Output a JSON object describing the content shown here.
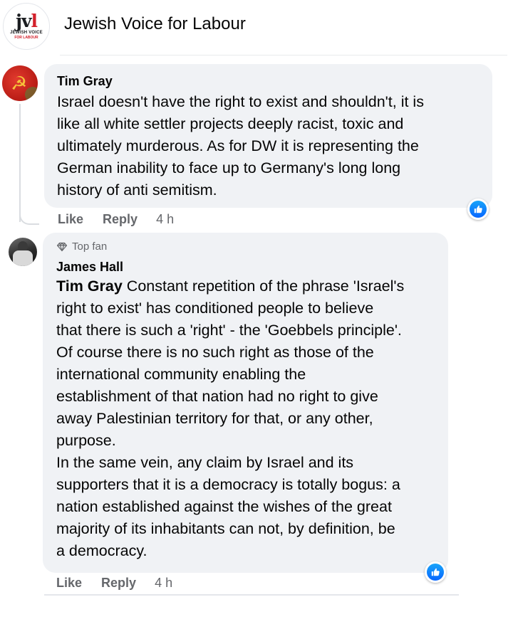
{
  "page": {
    "title": "Jewish Voice for Labour",
    "logo": {
      "mark_black": "jv",
      "mark_red": "l",
      "line1": "JEWISH VOICE",
      "line2": "FOR LABOUR"
    }
  },
  "comments": [
    {
      "author": "Tim Gray",
      "text": "Israel doesn't have the right to exist and shouldn't, it is\nlike all white settler projects deeply racist, toxic and\nultimately murderous. As for DW it is representing the\nGerman inability to face up to Germany's long long\nhistory of anti semitism.",
      "actions": {
        "like": "Like",
        "reply": "Reply"
      },
      "timestamp": "4 h",
      "reaction_icon": "like-thumb-icon"
    },
    {
      "badge": "Top fan",
      "author": "James Hall",
      "mention": "Tim Gray",
      "text": " Constant repetition of the phrase 'Israel's\nright to exist' has conditioned people to believe\nthat there is such a 'right' - the 'Goebbels principle'.\nOf course there is no such right as those of the\ninternational community enabling the\nestablishment of that nation had no right to give\naway Palestinian territory for that, or any other,\npurpose.\nIn the same vein, any claim by Israel and its\nsupporters that it is a democracy is totally bogus: a\nnation established against the wishes of the great\nmajority of its inhabitants can not, by definition, be\na democracy.",
      "actions": {
        "like": "Like",
        "reply": "Reply"
      },
      "timestamp": "4 h",
      "reaction_icon": "like-thumb-icon"
    }
  ],
  "colors": {
    "bubble": "#f0f2f5",
    "secondary_text": "#65676b",
    "like_blue": "#0866ff",
    "logo_red": "#d3202b"
  }
}
